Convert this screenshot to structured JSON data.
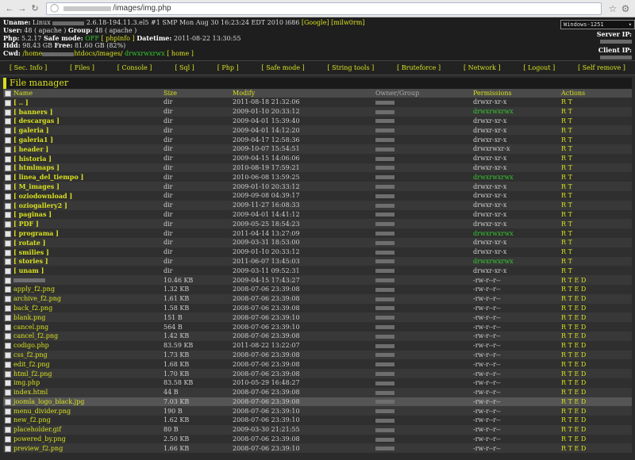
{
  "browser": {
    "url_suffix": "/images/img.php"
  },
  "info": {
    "uname_label": "Uname:",
    "uname_value": "2.6.18-194.11.3.el5 #1 SMP Mon Aug 30 16:23:24 EDT 2010 i686",
    "google": "[Google]",
    "milw0rm": "[milw0rm]",
    "user_label": "User:",
    "user_value": "48 ( apache )",
    "group_label": "Group:",
    "group_value": "48 ( apache )",
    "php_label": "Php:",
    "php_version": "5.2.17",
    "safe_label": "Safe mode:",
    "safe_value": "OFF",
    "phpinfo": "[ phpinfo ]",
    "datetime_label": "Datetime:",
    "datetime_value": "2011-08-22 13:30:55",
    "hdd_label": "Hdd:",
    "hdd_total": "98.43 GB",
    "free_label": "Free:",
    "hdd_free": "81.60 GB (82%)",
    "cwd_label": "Cwd:",
    "cwd_prefix": "/home",
    "cwd_mid": "htdocs/images/",
    "cwd_perm": "drwxrwxrwx",
    "cwd_home": "[ home ]",
    "charset": "Windows-1251",
    "server_ip_label": "Server IP:",
    "client_ip_label": "Client IP:"
  },
  "menu": [
    "[ Sec. Info ]",
    "[ Files ]",
    "[ Console ]",
    "[ Sql ]",
    "[ Php ]",
    "[ Safe mode ]",
    "[ String tools ]",
    "[ Bruteforce ]",
    "[ Network ]",
    "[ Logout ]",
    "[ Self remove ]"
  ],
  "fm": {
    "title": "File manager",
    "columns": [
      "Name",
      "Size",
      "Modify",
      "Owner/Group",
      "Permissions",
      "Actions"
    ],
    "rows": [
      {
        "name": "[ .. ]",
        "dir": true,
        "size": "dir",
        "modify": "2011-08-18 21:32:06",
        "perm": "drwxr-xr-x",
        "writable": false,
        "acts": "R T"
      },
      {
        "name": "[ banners ]",
        "dir": true,
        "size": "dir",
        "modify": "2009-01-10 20:33:12",
        "perm": "drwxrwxrwx",
        "writable": true,
        "acts": "R T"
      },
      {
        "name": "[ descargas ]",
        "dir": true,
        "size": "dir",
        "modify": "2009-04-01 15:39:40",
        "perm": "drwxr-xr-x",
        "writable": false,
        "acts": "R T"
      },
      {
        "name": "[ galeria ]",
        "dir": true,
        "size": "dir",
        "modify": "2009-04-01 14:12:20",
        "perm": "drwxr-xr-x",
        "writable": false,
        "acts": "R T"
      },
      {
        "name": "[ galeria1 ]",
        "dir": true,
        "size": "dir",
        "modify": "2009-04-17 12:58:36",
        "perm": "drwxr-xr-x",
        "writable": false,
        "acts": "R T"
      },
      {
        "name": "[ header ]",
        "dir": true,
        "size": "dir",
        "modify": "2009-10-07 15:54:51",
        "perm": "drwxrwxr-x",
        "writable": false,
        "acts": "R T"
      },
      {
        "name": "[ historia ]",
        "dir": true,
        "size": "dir",
        "modify": "2009-04-15 14:06:06",
        "perm": "drwxr-xr-x",
        "writable": false,
        "acts": "R T"
      },
      {
        "name": "[ htmlmaps ]",
        "dir": true,
        "size": "dir",
        "modify": "2010-08-19 17:59:21",
        "perm": "drwxr-xr-x",
        "writable": false,
        "acts": "R T"
      },
      {
        "name": "[ linea_del_tiempo ]",
        "dir": true,
        "size": "dir",
        "modify": "2010-06-08 13:59:25",
        "perm": "drwxrwxrwx",
        "writable": true,
        "acts": "R T"
      },
      {
        "name": "[ M_images ]",
        "dir": true,
        "size": "dir",
        "modify": "2009-01-10 20:33:12",
        "perm": "drwxr-xr-x",
        "writable": false,
        "acts": "R T"
      },
      {
        "name": "[ oziodownload ]",
        "dir": true,
        "size": "dir",
        "modify": "2009-09-08 04:39:17",
        "perm": "drwxr-xr-x",
        "writable": false,
        "acts": "R T"
      },
      {
        "name": "[ oziogallery2 ]",
        "dir": true,
        "size": "dir",
        "modify": "2009-11-27 16:08:33",
        "perm": "drwxr-xr-x",
        "writable": false,
        "acts": "R T"
      },
      {
        "name": "[ paginas ]",
        "dir": true,
        "size": "dir",
        "modify": "2009-04-01 14:41:12",
        "perm": "drwxr-xr-x",
        "writable": false,
        "acts": "R T"
      },
      {
        "name": "[ PDF ]",
        "dir": true,
        "size": "dir",
        "modify": "2009-05-25 18:54:23",
        "perm": "drwxr-xr-x",
        "writable": false,
        "acts": "R T"
      },
      {
        "name": "[ programa ]",
        "dir": true,
        "size": "dir",
        "modify": "2011-04-14 13:27:09",
        "perm": "drwxrwxrwx",
        "writable": true,
        "acts": "R T"
      },
      {
        "name": "[ rotate ]",
        "dir": true,
        "size": "dir",
        "modify": "2009-03-31 18:53:00",
        "perm": "drwxr-xr-x",
        "writable": false,
        "acts": "R T"
      },
      {
        "name": "[ smilies ]",
        "dir": true,
        "size": "dir",
        "modify": "2009-01-10 20:33:12",
        "perm": "drwxr-xr-x",
        "writable": false,
        "acts": "R T"
      },
      {
        "name": "[ stories ]",
        "dir": true,
        "size": "dir",
        "modify": "2011-06-07 13:45:03",
        "perm": "drwxrwxrwx",
        "writable": true,
        "acts": "R T"
      },
      {
        "name": "[ unam ]",
        "dir": true,
        "size": "dir",
        "modify": "2009-03-11 09:52:31",
        "perm": "drwxr-xr-x",
        "writable": false,
        "acts": "R T"
      },
      {
        "name": "",
        "dir": false,
        "blurred": true,
        "size": "10.46 KB",
        "modify": "2009-04-15 17:43:27",
        "perm": "-rw-r--r--",
        "writable": false,
        "acts": "R T E D"
      },
      {
        "name": "apply_f2.png",
        "dir": false,
        "size": "1.32 KB",
        "modify": "2008-07-06 23:39:08",
        "perm": "-rw-r--r--",
        "writable": false,
        "acts": "R T E D"
      },
      {
        "name": "archive_f2.png",
        "dir": false,
        "size": "1.61 KB",
        "modify": "2008-07-06 23:39:08",
        "perm": "-rw-r--r--",
        "writable": false,
        "acts": "R T E D"
      },
      {
        "name": "back_f2.png",
        "dir": false,
        "size": "1.58 KB",
        "modify": "2008-07-06 23:39:08",
        "perm": "-rw-r--r--",
        "writable": false,
        "acts": "R T E D"
      },
      {
        "name": "blank.png",
        "dir": false,
        "size": "151 B",
        "modify": "2008-07-06 23:39:10",
        "perm": "-rw-r--r--",
        "writable": false,
        "acts": "R T E D"
      },
      {
        "name": "cancel.png",
        "dir": false,
        "size": "564 B",
        "modify": "2008-07-06 23:39:10",
        "perm": "-rw-r--r--",
        "writable": false,
        "acts": "R T E D"
      },
      {
        "name": "cancel_f2.png",
        "dir": false,
        "size": "1.42 KB",
        "modify": "2008-07-06 23:39:08",
        "perm": "-rw-r--r--",
        "writable": false,
        "acts": "R T E D"
      },
      {
        "name": "codigo.php",
        "dir": false,
        "size": "83.59 KB",
        "modify": "2011-08-22 13:22:07",
        "perm": "-rw-r--r--",
        "writable": false,
        "acts": "R T E D"
      },
      {
        "name": "css_f2.png",
        "dir": false,
        "size": "1.73 KB",
        "modify": "2008-07-06 23:39:08",
        "perm": "-rw-r--r--",
        "writable": false,
        "acts": "R T E D"
      },
      {
        "name": "edit_f2.png",
        "dir": false,
        "size": "1.68 KB",
        "modify": "2008-07-06 23:39:08",
        "perm": "-rw-r--r--",
        "writable": false,
        "acts": "R T E D"
      },
      {
        "name": "html_f2.png",
        "dir": false,
        "size": "1.70 KB",
        "modify": "2008-07-06 23:39:08",
        "perm": "-rw-r--r--",
        "writable": false,
        "acts": "R T E D"
      },
      {
        "name": "img.php",
        "dir": false,
        "size": "83.58 KB",
        "modify": "2010-05-29 16:48:27",
        "perm": "-rw-r--r--",
        "writable": false,
        "acts": "R T E D"
      },
      {
        "name": "index.html",
        "dir": false,
        "size": "44 B",
        "modify": "2008-07-06 23:39:08",
        "perm": "-rw-r--r--",
        "writable": false,
        "acts": "R T E D"
      },
      {
        "name": "joomla_logo_black.jpg",
        "dir": false,
        "size": "7.03 KB",
        "modify": "2008-07-06 23:39:08",
        "perm": "-rw-r--r--",
        "writable": false,
        "acts": "R T E D",
        "highlight": true
      },
      {
        "name": "menu_divider.png",
        "dir": false,
        "size": "190 B",
        "modify": "2008-07-06 23:39:10",
        "perm": "-rw-r--r--",
        "writable": false,
        "acts": "R T E D"
      },
      {
        "name": "new_f2.png",
        "dir": false,
        "size": "1.62 KB",
        "modify": "2008-07-06 23:39:10",
        "perm": "-rw-r--r--",
        "writable": false,
        "acts": "R T E D"
      },
      {
        "name": "placeholder.gif",
        "dir": false,
        "size": "80 B",
        "modify": "2009-03-30 21:21:55",
        "perm": "-rw-r--r--",
        "writable": false,
        "acts": "R T E D"
      },
      {
        "name": "powered_by.png",
        "dir": false,
        "size": "2.50 KB",
        "modify": "2008-07-06 23:39:08",
        "perm": "-rw-r--r--",
        "writable": false,
        "acts": "R T E D"
      },
      {
        "name": "preview_f2.png",
        "dir": false,
        "size": "1.66 KB",
        "modify": "2008-07-06 23:39:10",
        "perm": "-rw-r--r--",
        "writable": false,
        "acts": "R T E D"
      }
    ]
  }
}
